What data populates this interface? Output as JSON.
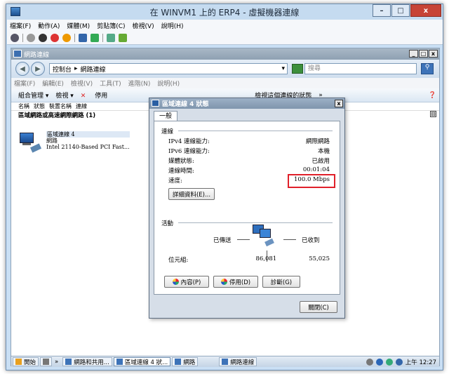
{
  "host": {
    "title": "在 WINVM1 上的 ERP4 - 虛擬機器連線",
    "minimize": "–",
    "maximize": "□",
    "close": "x",
    "menu": [
      "檔案(F)",
      "動作(A)",
      "媒體(M)",
      "剪貼簿(C)",
      "檢視(V)",
      "說明(H)"
    ]
  },
  "explorer": {
    "title": "網路連線",
    "address": [
      "控制台",
      "網路連線"
    ],
    "search_placeholder": "搜尋",
    "menu": [
      "檔案(F)",
      "編輯(E)",
      "檢視(V)",
      "工具(T)",
      "進階(N)",
      "說明(H)"
    ],
    "commands": {
      "organize": "組合管理 ▾",
      "views": "檢視 ▾",
      "disable": "停用",
      "view_status": "檢視這個連線的狀態",
      "more": "»"
    },
    "columns": [
      "名稱",
      "狀態",
      "裝置名稱",
      "連線"
    ],
    "group": "區域網路或高速網際網路 (1)",
    "collapse": "⊟",
    "connection": {
      "name": "區域連線 4",
      "status": "網路",
      "device": "Intel 21140-Based PCI Fast..."
    }
  },
  "dialog": {
    "title": "區域連線 4 狀態",
    "close": "x",
    "tab": "一般",
    "connection_label": "連線",
    "rows": [
      {
        "label": "IPv4 連線能力:",
        "value": "網際網路"
      },
      {
        "label": "IPv6 連線能力:",
        "value": "本機"
      },
      {
        "label": "媒體狀態:",
        "value": "已啟用"
      },
      {
        "label": "連線時間:",
        "value": "00:01:04"
      },
      {
        "label": "速度:",
        "value": "100.0 Mbps"
      }
    ],
    "details_button": "詳細資料(E)...",
    "activity_label": "活動",
    "sent_label": "已傳送",
    "received_label": "已收到",
    "bytes_label": "位元組:",
    "bytes_sent": "86,081",
    "bytes_received": "55,025",
    "properties_button": "內容(P)",
    "disable_button": "停用(D)",
    "diagnose_button": "診斷(G)",
    "closebtn": "關閉(C)"
  },
  "taskbar": {
    "start": "開始",
    "more": "»",
    "items": [
      "網路和共用...",
      "區域連線 4 狀...",
      "網路",
      "網路連線"
    ],
    "clock": "上午 12:27"
  }
}
